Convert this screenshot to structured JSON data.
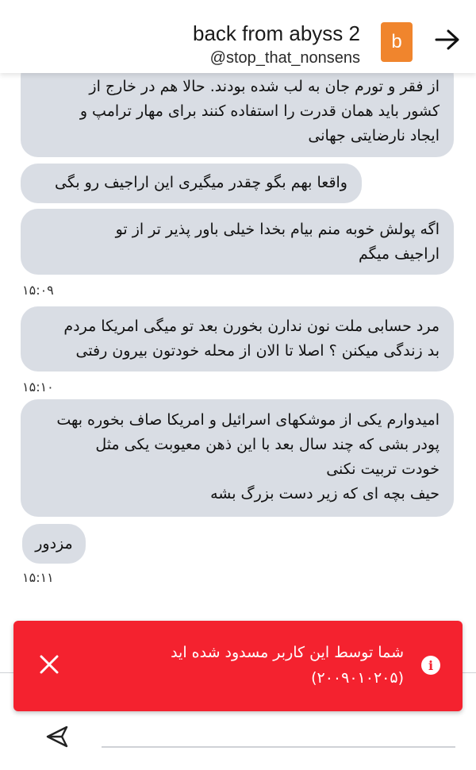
{
  "header": {
    "title": "back from abyss 2",
    "handle": "@stop_that_nonsens",
    "avatar_letter": "b",
    "avatar_color": "#f0852d",
    "back_icon": "arrow-right-icon"
  },
  "messages": [
    {
      "lines": [
        "از فقر و تورم جان به لب شده بودند. حالا هم در خارج از",
        "کشور باید همان قدرت را استفاده کنند برای مهار ترامپ و",
        "ایجاد نارضایتی جهانی"
      ]
    },
    {
      "lines": [
        "واقعا بهم بگو چقدر میگیری این اراجیف رو بگی"
      ]
    },
    {
      "lines": [
        "اگه پولش خوبه منم بیام بخدا خیلی باور پذیر تر از تو",
        "اراجیف میگم"
      ],
      "time": "۱۵:۰۹"
    },
    {
      "lines": [
        "مرد حسابی ملت نون ندارن بخورن بعد تو میگی امریکا مردم",
        "بد زندگی میکنن ؟ اصلا تا الان از محله خودتون بیرون رفتی"
      ],
      "time": "۱۵:۱۰"
    },
    {
      "lines": [
        "امیدوارم یکی از موشکهای اسرائیل و امریکا صاف بخوره بهت",
        "پودر بشی که چند سال بعد با این ذهن معیوبت یکی مثل",
        "خودت تربیت نکنی",
        "حیف بچه ای که زیر دست بزرگ بشه"
      ]
    },
    {
      "lines": [
        "مزدور"
      ],
      "time": "۱۵:۱۱"
    }
  ],
  "banner": {
    "line1": "شما توسط این کاربر مسدود شده اید",
    "line2": "(۲۰۰۹۰۱۰۲۰۵)",
    "background": "#f4222f",
    "info_icon": "info-icon",
    "close_icon": "close-icon"
  },
  "composer": {
    "send_icon": "send-icon"
  }
}
